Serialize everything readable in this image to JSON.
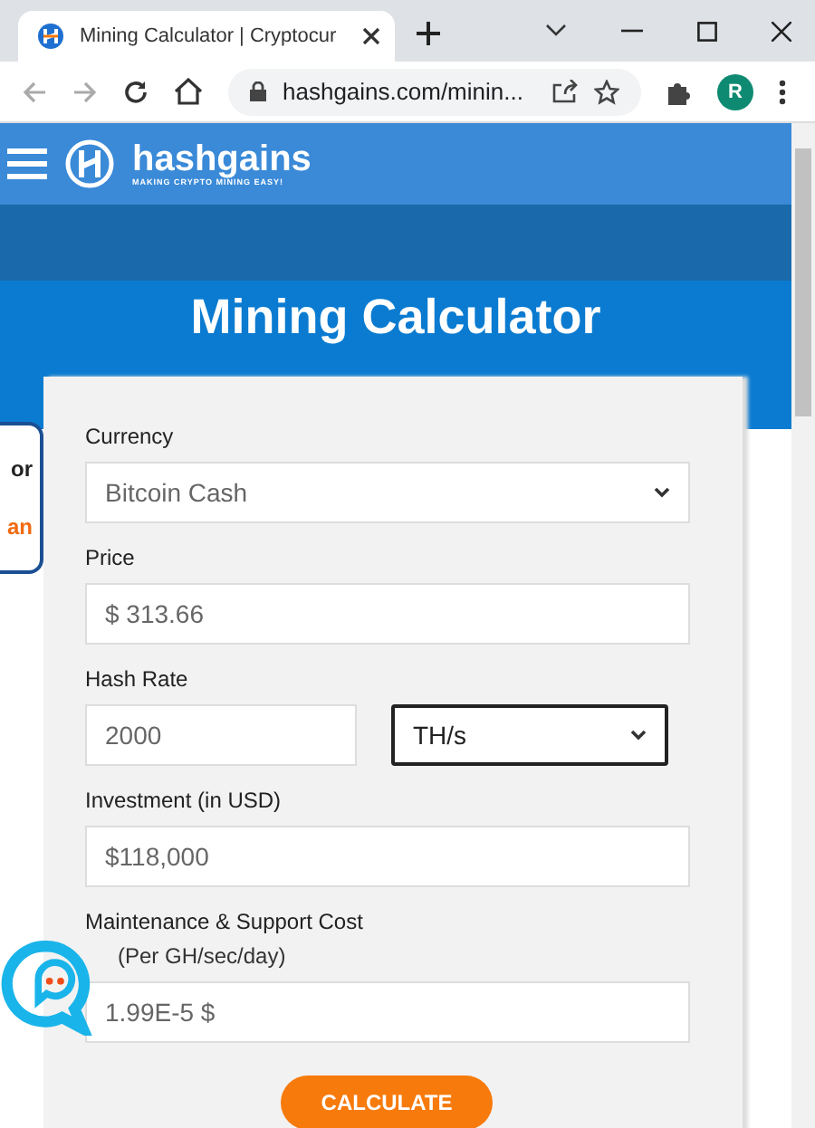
{
  "browser": {
    "tab_title": "Mining Calculator | Cryptocur",
    "address": "hashgains.com/minin...",
    "profile": "R"
  },
  "site": {
    "logo": "hashgains",
    "tagline": "MAKING CRYPTO MINING EASY!"
  },
  "page_title": "Mining Calculator",
  "callout": [
    "or",
    "an"
  ],
  "form": {
    "fields": [
      {
        "kind": "select",
        "label": "Currency",
        "value": "Bitcoin Cash"
      },
      {
        "kind": "input",
        "label": "Price",
        "value": "$ 313.66"
      },
      {
        "kind": "pair",
        "label": "Hash Rate",
        "value": "2000",
        "unit": "TH/s",
        "unit_focused": true
      },
      {
        "kind": "input",
        "label": "Investment (in USD)",
        "value": "$118,000"
      },
      {
        "kind": "input",
        "label": "Maintenance & Support Cost",
        "sublabel": "(Per GH/sec/day)",
        "value": "1.99E-5 $"
      }
    ],
    "button": "CALCULATE"
  }
}
